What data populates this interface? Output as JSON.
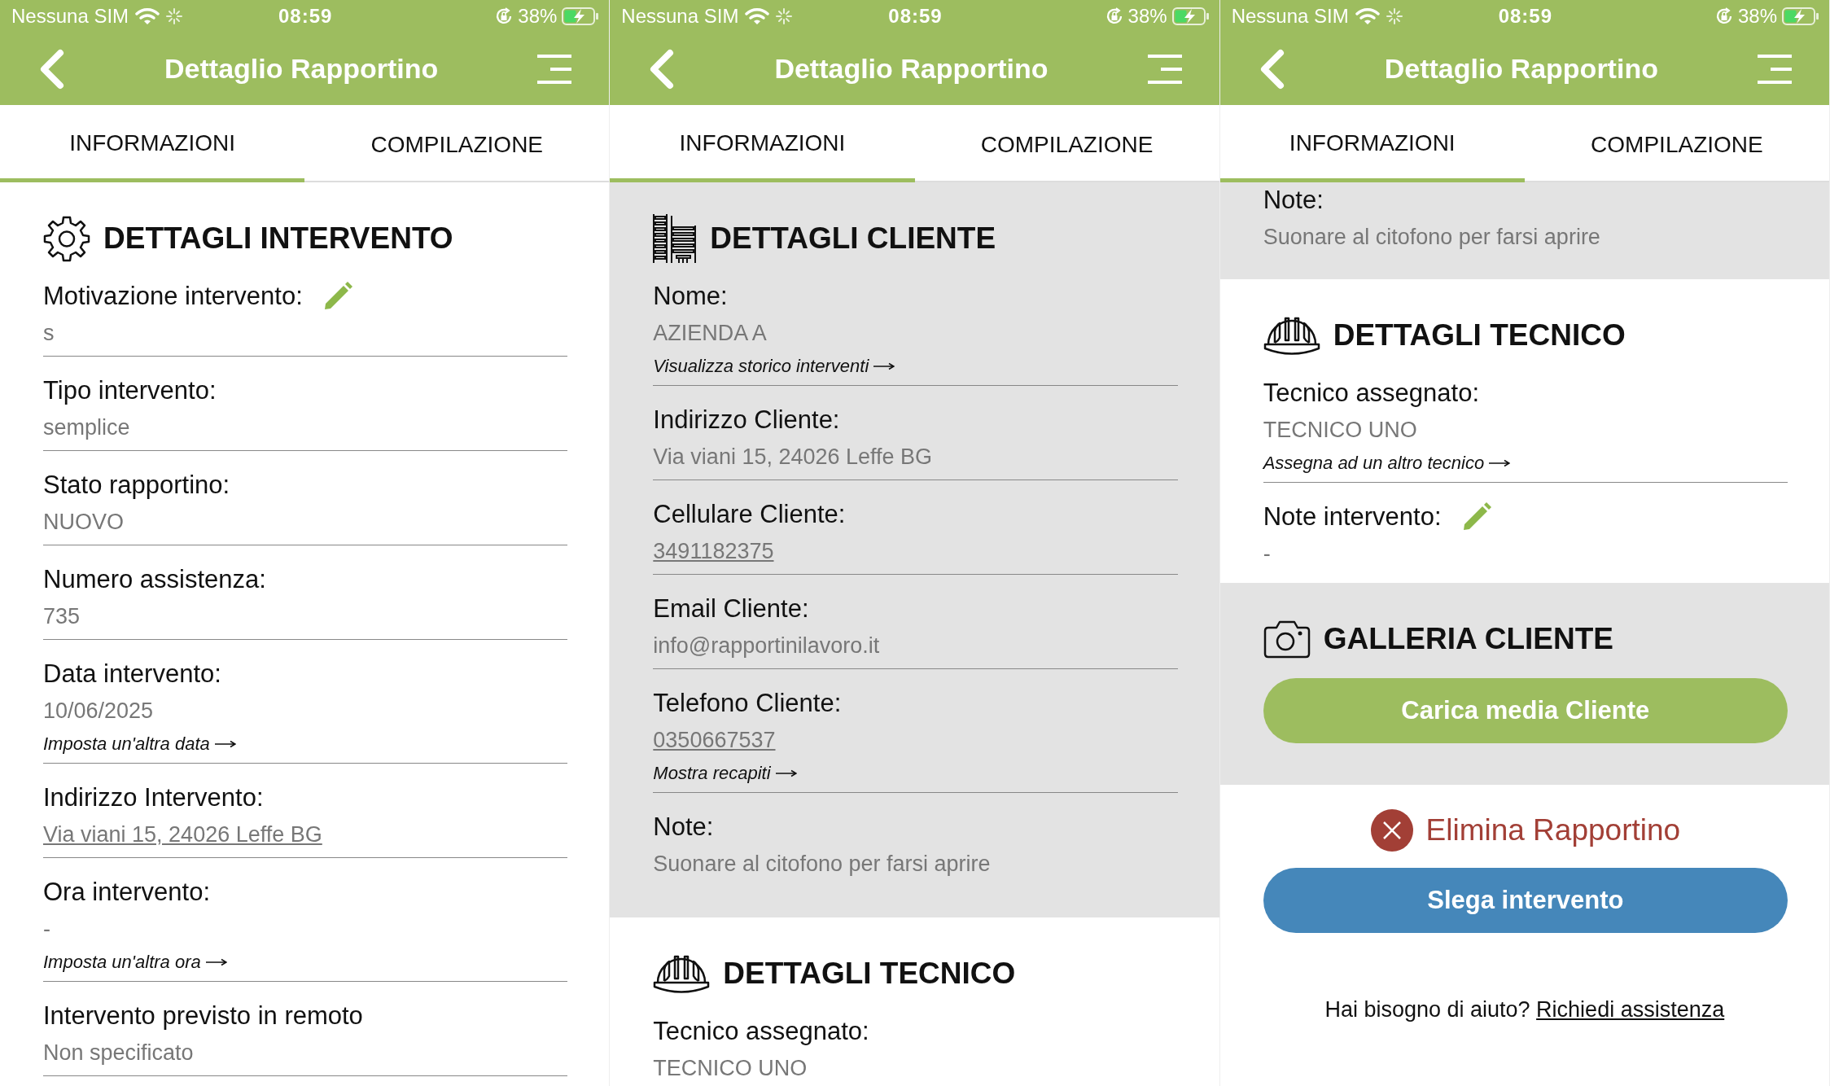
{
  "screens": [
    {
      "status_bar": {
        "carrier": "Nessuna SIM",
        "time": "08:59",
        "battery": "38%"
      },
      "header": {
        "title": "Dettaglio Rapportino"
      },
      "tabs": [
        {
          "label": "INFORMAZIONI",
          "selected": true
        },
        {
          "label": "COMPILAZIONE",
          "selected": false
        }
      ],
      "scrolled": false,
      "sections": [
        {
          "kind": "intervento",
          "title": "DETTAGLI INTERVENTO",
          "fields": [
            {
              "label": "Motivazione intervento:",
              "editable": true,
              "value": "s",
              "underlined": false
            },
            {
              "label": "Tipo intervento:",
              "editable": false,
              "value": "semplice",
              "underlined": false
            },
            {
              "label": "Stato rapportino:",
              "editable": false,
              "value": "NUOVO",
              "underlined": false
            },
            {
              "label": "Numero assistenza:",
              "editable": false,
              "value": "735",
              "underlined": false
            },
            {
              "label": "Data intervento:",
              "editable": false,
              "value": "10/06/2025",
              "underlined": false,
              "action": "Imposta un'altra data"
            },
            {
              "label": "Indirizzo Intervento:",
              "editable": false,
              "value": "Via viani 15, 24026 Leffe  BG",
              "underlined": true
            },
            {
              "label": "Ora intervento:",
              "editable": false,
              "value": "-",
              "underlined": false,
              "action": "Imposta un'altra ora"
            },
            {
              "label": "Intervento previsto in remoto",
              "editable": false,
              "value": "Non specificato",
              "underlined": false
            }
          ]
        }
      ]
    },
    {
      "status_bar": {
        "carrier": "Nessuna SIM",
        "time": "08:59",
        "battery": "38%"
      },
      "header": {
        "title": "Dettaglio Rapportino"
      },
      "tabs": [
        {
          "label": "INFORMAZIONI",
          "selected": true
        },
        {
          "label": "COMPILAZIONE",
          "selected": false
        }
      ],
      "scrolled": false,
      "sections": [
        {
          "kind": "cliente",
          "title": "DETTAGLI CLIENTE",
          "fields": [
            {
              "label": "Nome:",
              "editable": false,
              "value": "AZIENDA A",
              "underlined": false,
              "action": "Visualizza storico interventi"
            },
            {
              "label": "Indirizzo Cliente:",
              "editable": false,
              "value": "Via viani 15, 24026 Leffe  BG",
              "underlined": false
            },
            {
              "label": "Cellulare Cliente:",
              "editable": false,
              "value": "3491182375",
              "underlined": true
            },
            {
              "label": "Email Cliente:",
              "editable": false,
              "value": "info@rapportinilavoro.it",
              "underlined": false
            },
            {
              "label": "Telefono Cliente:",
              "editable": false,
              "value": "0350667537",
              "underlined": true,
              "action": "Mostra recapiti"
            },
            {
              "label": "Note:",
              "editable": false,
              "value": "Suonare al citofono per farsi aprire",
              "underlined": false
            }
          ]
        },
        {
          "kind": "tecnico",
          "title": "DETTAGLI TECNICO",
          "fields": [
            {
              "label": "Tecnico assegnato:",
              "editable": false,
              "value": "TECNICO UNO",
              "underlined": false
            }
          ]
        }
      ]
    },
    {
      "status_bar": {
        "carrier": "Nessuna SIM",
        "time": "08:59",
        "battery": "38%"
      },
      "header": {
        "title": "Dettaglio Rapportino"
      },
      "tabs": [
        {
          "label": "INFORMAZIONI",
          "selected": true
        },
        {
          "label": "COMPILAZIONE",
          "selected": false
        }
      ],
      "scrolled": true,
      "sections": [
        {
          "kind": "cliente",
          "fields": [
            {
              "label": "Note:",
              "editable": false,
              "value": "Suonare al citofono per farsi aprire",
              "underlined": false
            }
          ]
        },
        {
          "kind": "tecnico",
          "title": "DETTAGLI TECNICO",
          "fields": [
            {
              "label": "Tecnico assegnato:",
              "editable": false,
              "value": "TECNICO UNO",
              "underlined": false,
              "action": "Assegna ad un altro tecnico"
            },
            {
              "label": "Note intervento:",
              "editable": true,
              "value": "-",
              "underlined": false
            }
          ]
        },
        {
          "kind": "galleria",
          "title": "GALLERIA CLIENTE",
          "buttons": [
            {
              "label": "Carica media Cliente"
            }
          ]
        }
      ],
      "actions": [
        {
          "kind": "delete",
          "label": "Elimina Rapportino"
        },
        {
          "kind": "secondary",
          "label": "Slega intervento"
        }
      ],
      "help": {
        "text": "Hai bisogno di aiuto?",
        "link": "Richiedi assistenza"
      }
    }
  ]
}
